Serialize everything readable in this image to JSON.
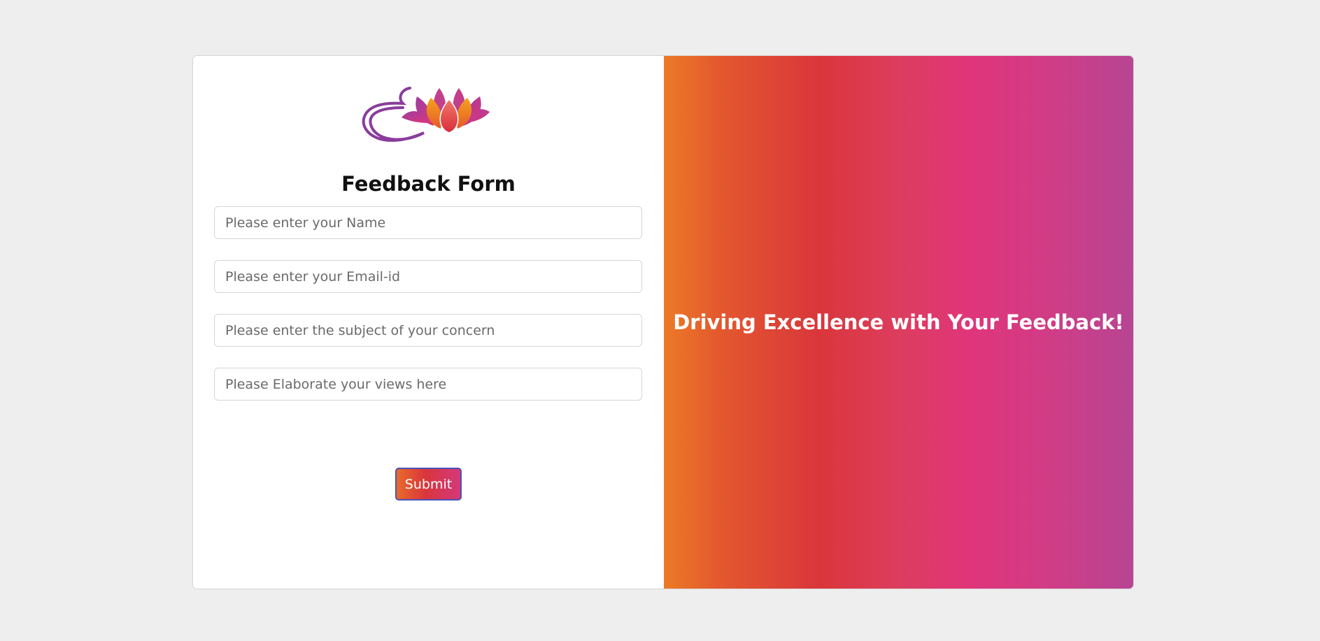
{
  "form": {
    "title": "Feedback Form",
    "fields": [
      {
        "placeholder": "Please enter your Name"
      },
      {
        "placeholder": "Please enter your Email-id"
      },
      {
        "placeholder": "Please enter the subject of your concern"
      },
      {
        "placeholder": "Please Elaborate your views here"
      }
    ],
    "submit_label": "Submit"
  },
  "banner": {
    "tagline": "Driving Excellence with Your Feedback!"
  },
  "colors": {
    "page_background": "#eeeeee",
    "gradient_start": "#ec7a26",
    "gradient_mid": "#d9363b",
    "gradient_pink": "#e0357a",
    "gradient_end": "#b74592",
    "submit_border": "#4a52b8"
  },
  "icons": {
    "logo": "lotus-logo-icon"
  }
}
